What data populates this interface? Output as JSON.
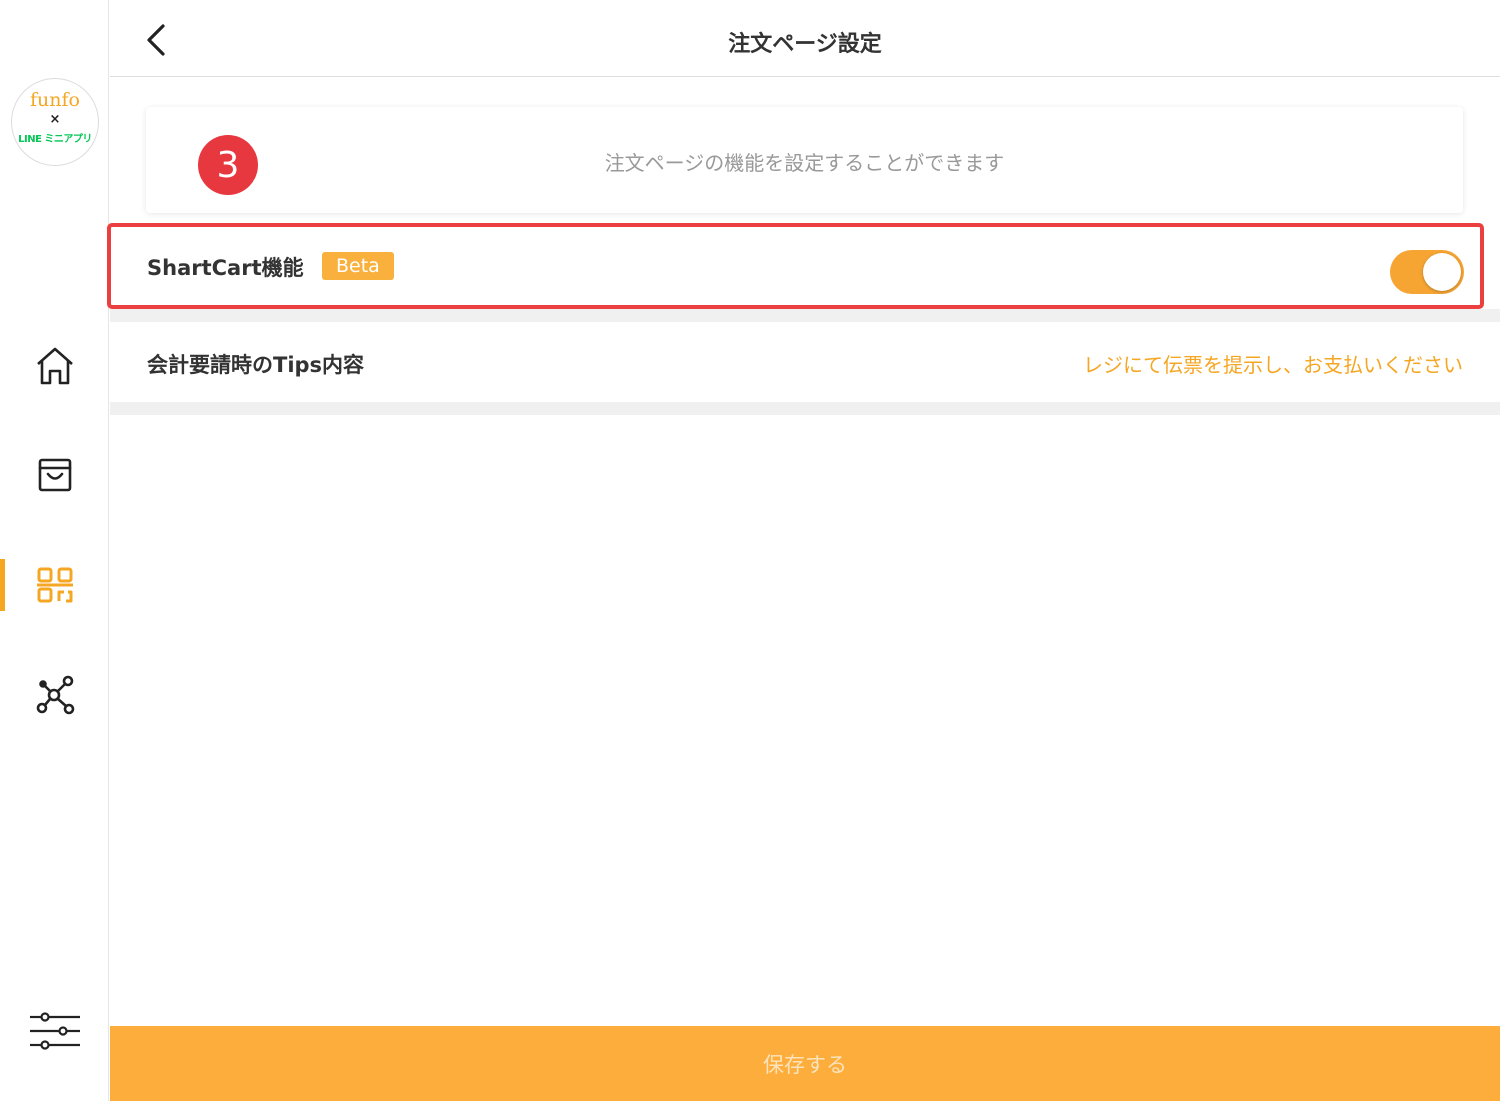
{
  "sidebar": {
    "logo": {
      "brand": "funfo",
      "separator": "×",
      "partner": "LINE ミニアプリ"
    },
    "items": [
      {
        "name": "home",
        "icon": "home-icon",
        "active": false
      },
      {
        "name": "shop",
        "icon": "shopping-bag-icon",
        "active": false
      },
      {
        "name": "qr",
        "icon": "qr-code-icon",
        "active": true
      },
      {
        "name": "network",
        "icon": "network-icon",
        "active": false
      }
    ],
    "settings_icon": "sliders-icon"
  },
  "header": {
    "title": "注文ページ設定",
    "back_icon": "chevron-left-icon"
  },
  "info": {
    "step": "3",
    "text": "注文ページの機能を設定することができます"
  },
  "shartcart": {
    "label": "ShartCart機能",
    "badge": "Beta",
    "enabled": true
  },
  "tips": {
    "label": "会計要請時のTips内容",
    "value": "レジにて伝票を提示し、お支払いください"
  },
  "save": {
    "label": "保存する"
  },
  "colors": {
    "accent": "#f5a623",
    "toggle_on": "#f6a533",
    "save_bg": "#fcad3b",
    "highlight": "#ec4040",
    "step_badge": "#e8383f"
  }
}
